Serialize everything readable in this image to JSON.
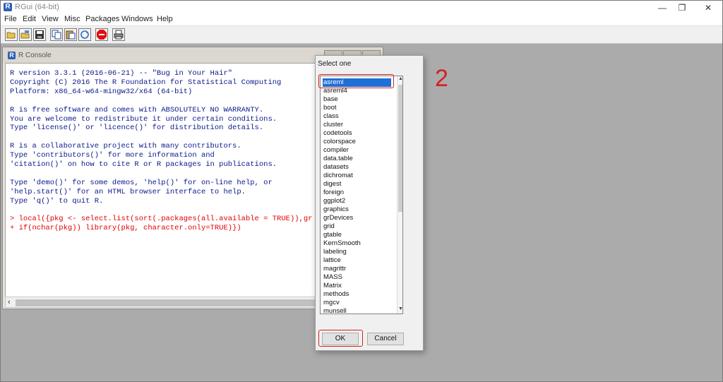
{
  "app": {
    "title": "RGui (64-bit)",
    "icon_letter": "R",
    "window_controls": [
      "—",
      "❐",
      "✕"
    ]
  },
  "menubar": [
    "File",
    "Edit",
    "View",
    "Misc",
    "Packages",
    "Windows",
    "Help"
  ],
  "toolbar": [
    "open-script",
    "load-workspace",
    "save-workspace",
    "copy",
    "paste",
    "copy-paste",
    "stop",
    "print"
  ],
  "console": {
    "title": "R Console",
    "icon_letter": "R",
    "lines": [
      {
        "text": "R version 3.3.1 (2016-06-21) -- \"Bug in Your Hair\"",
        "kind": "output"
      },
      {
        "text": "Copyright (C) 2016 The R Foundation for Statistical Computing",
        "kind": "output"
      },
      {
        "text": "Platform: x86_64-w64-mingw32/x64 (64-bit)",
        "kind": "output"
      },
      {
        "text": "",
        "kind": "output"
      },
      {
        "text": "R is free software and comes with ABSOLUTELY NO WARRANTY.",
        "kind": "output"
      },
      {
        "text": "You are welcome to redistribute it under certain conditions.",
        "kind": "output"
      },
      {
        "text": "Type 'license()' or 'licence()' for distribution details.",
        "kind": "output"
      },
      {
        "text": "",
        "kind": "output"
      },
      {
        "text": "R is a collaborative project with many contributors.",
        "kind": "output"
      },
      {
        "text": "Type 'contributors()' for more information and",
        "kind": "output"
      },
      {
        "text": "'citation()' on how to cite R or R packages in publications.",
        "kind": "output"
      },
      {
        "text": "",
        "kind": "output"
      },
      {
        "text": "Type 'demo()' for some demos, 'help()' for on-line help, or",
        "kind": "output"
      },
      {
        "text": "'help.start()' for an HTML browser interface to help.",
        "kind": "output"
      },
      {
        "text": "Type 'q()' to quit R.",
        "kind": "output"
      },
      {
        "text": "",
        "kind": "output"
      },
      {
        "text": "> local({pkg <- select.list(sort(.packages(all.available = TRUE)),gr",
        "kind": "input"
      },
      {
        "text": "+ if(nchar(pkg)) library(pkg, character.only=TRUE)})",
        "kind": "input"
      }
    ]
  },
  "dialog": {
    "title": "Select one",
    "selected": "asreml",
    "items": [
      "asreml",
      "asreml4",
      "base",
      "boot",
      "class",
      "cluster",
      "codetools",
      "colorspace",
      "compiler",
      "data.table",
      "datasets",
      "dichromat",
      "digest",
      "foreign",
      "ggplot2",
      "graphics",
      "grDevices",
      "grid",
      "gtable",
      "KernSmooth",
      "labeling",
      "lattice",
      "magrittr",
      "MASS",
      "Matrix",
      "methods",
      "mgcv",
      "munsell"
    ],
    "ok_label": "OK",
    "cancel_label": "Cancel"
  },
  "annotation": {
    "step_number": "2",
    "color": "#d32020"
  }
}
